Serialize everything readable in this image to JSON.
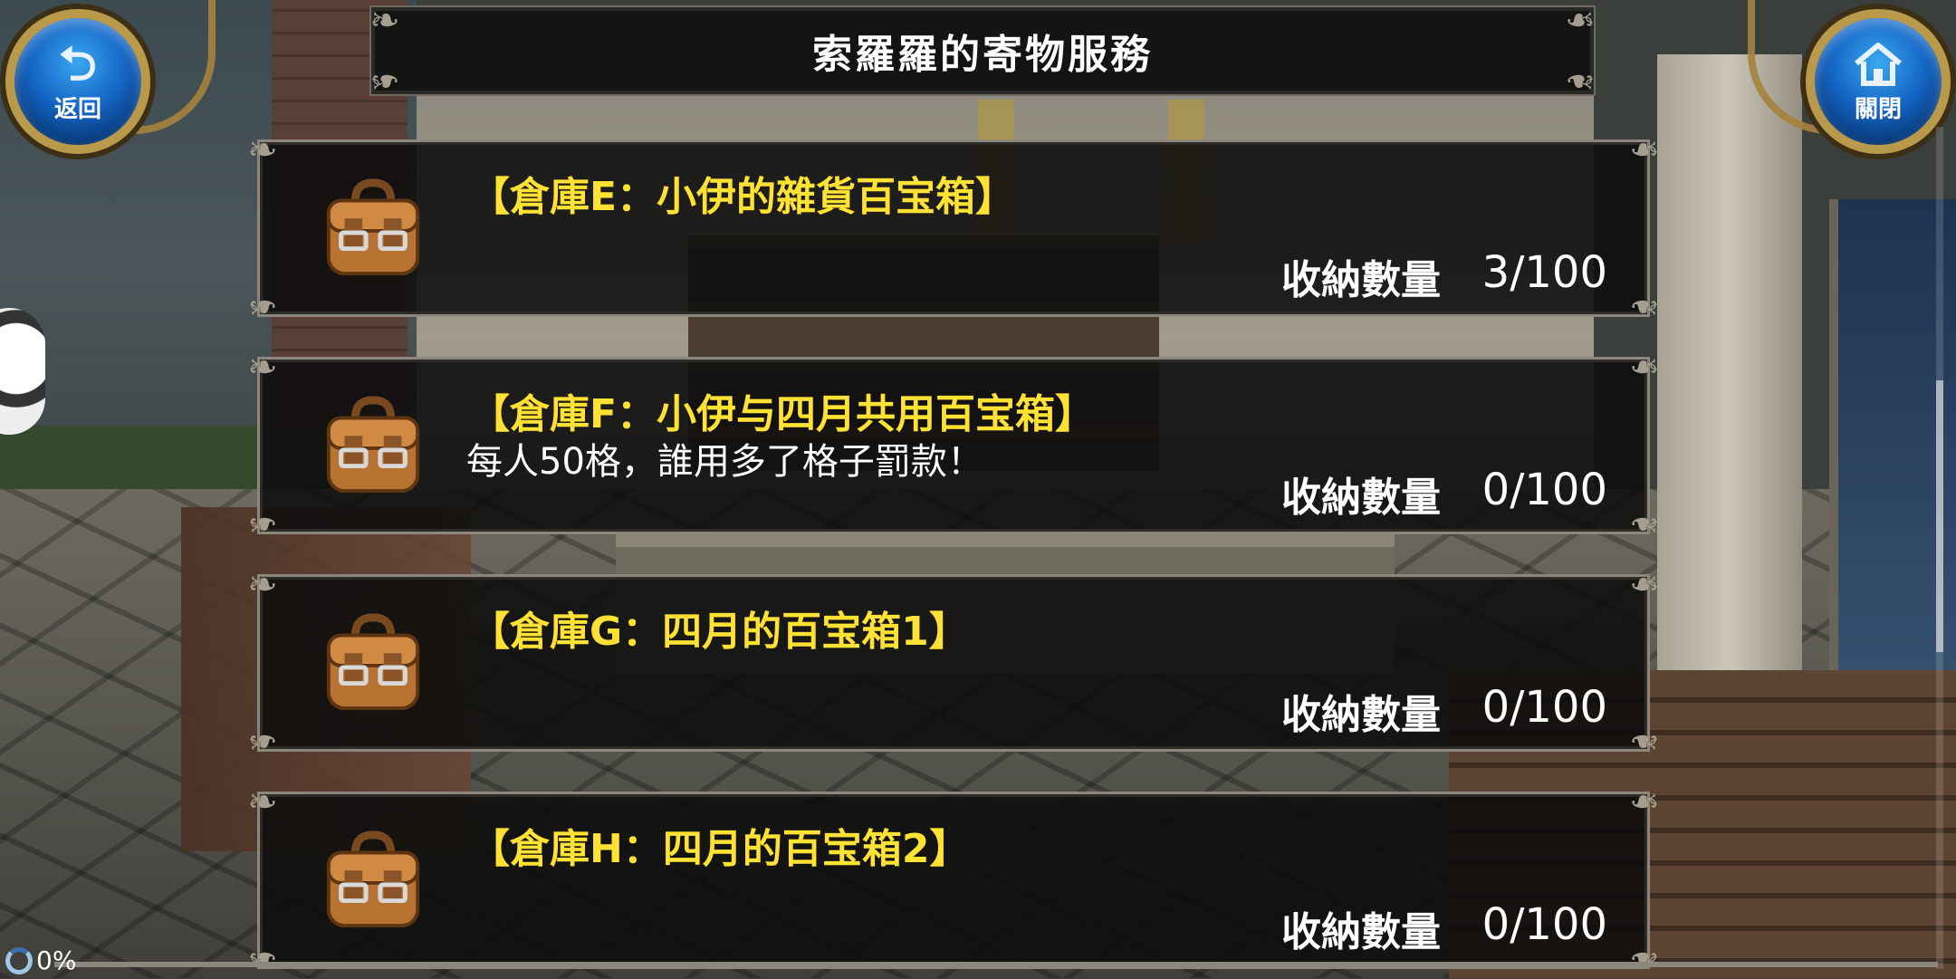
{
  "header": {
    "title": "索羅羅的寄物服務",
    "back_label": "返回",
    "close_label": "關閉"
  },
  "storage": [
    {
      "name": "【倉庫E：小伊的雜貨百宝箱】",
      "description": "",
      "capacity_label": "收納數量",
      "capacity": "3/100"
    },
    {
      "name": "【倉庫F：小伊与四月共用百宝箱】",
      "description": "每人50格，誰用多了格子罰款！",
      "capacity_label": "收納數量",
      "capacity": "0/100"
    },
    {
      "name": "【倉庫G：四月的百宝箱1】",
      "description": "",
      "capacity_label": "收納數量",
      "capacity": "0/100"
    },
    {
      "name": "【倉庫H：四月的百宝箱2】",
      "description": "",
      "capacity_label": "收納數量",
      "capacity": "0/100"
    }
  ],
  "status": {
    "loading_percent": "0%"
  },
  "colors": {
    "item_name": "#ffe234",
    "button_blue": "#1466c6",
    "frame_gold": "#b99a4a"
  },
  "icons": {
    "back": "return-arrow-icon",
    "close": "home-icon",
    "storage": "leather-bag-icon"
  }
}
